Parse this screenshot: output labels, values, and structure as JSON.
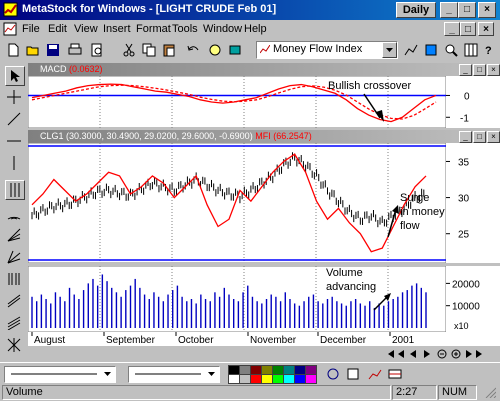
{
  "window": {
    "title": "MetaStock for Windows - [LIGHT CRUDE Feb 01]",
    "period_badge": "Daily",
    "control_min": "_",
    "control_max": "□",
    "control_close": "×"
  },
  "menu": {
    "items": [
      "File",
      "Edit",
      "View",
      "Insert",
      "Format",
      "Tools",
      "Window",
      "Help"
    ]
  },
  "toolbar": {
    "indicator_select": "Money Flow Index",
    "icons": [
      "new-icon",
      "open-icon",
      "save-icon",
      "print-icon",
      "cut-icon",
      "copy-icon",
      "paste-icon",
      "undo-icon",
      "explorer-icon",
      "expert-icon",
      "system-tester-icon",
      "indicator-builder-icon",
      "zoom-icon",
      "help-icon"
    ]
  },
  "macd_pane": {
    "label": "MACD",
    "value": "(0.0632)",
    "y_ticks": [
      "0",
      "-1"
    ],
    "annotation": "Bullish crossover"
  },
  "price_pane": {
    "label": "CLG1",
    "values": "(30.3000, 30.4900, 29.0200, 29.6000, -0.6900)",
    "mfi_label": "MFI",
    "mfi_value": "(66.2547)",
    "y_ticks": [
      "35",
      "30",
      "25"
    ],
    "annotation": "Surge in money flow"
  },
  "volume_pane": {
    "y_ticks": [
      "20000",
      "10000"
    ],
    "multiplier": "x10",
    "annotation": "Volume advancing"
  },
  "x_axis": {
    "labels": [
      "August",
      "September",
      "October",
      "November",
      "December",
      "2001"
    ]
  },
  "palette": {
    "colors": [
      "#000000",
      "#808080",
      "#800000",
      "#808000",
      "#008000",
      "#008080",
      "#000080",
      "#800080",
      "#ffffff",
      "#c0c0c0",
      "#ff0000",
      "#ffff00",
      "#00ff00",
      "#00ffff",
      "#0000ff",
      "#ff00ff"
    ]
  },
  "status": {
    "left": "Volume",
    "time": "2:27",
    "num": "NUM"
  },
  "chart_data": [
    {
      "type": "line",
      "pane": "MACD",
      "series": [
        {
          "name": "MACD",
          "values": [
            -0.1,
            0.0,
            0.1,
            0.2,
            0.35,
            0.45,
            0.5,
            0.52,
            0.5,
            0.4,
            0.3,
            0.2,
            0.15,
            0.05,
            -0.05,
            -0.2,
            -0.3,
            -0.35,
            -0.3,
            -0.2,
            -0.1,
            0.1,
            0.3,
            0.45,
            0.5,
            0.4,
            0.25,
            0.1,
            -0.2,
            -0.6,
            -0.9,
            -1.1,
            -1.2,
            -1.0,
            -0.6,
            -0.2,
            0.0
          ]
        },
        {
          "name": "Signal",
          "values": [
            -0.2,
            -0.1,
            0.0,
            0.1,
            0.2,
            0.3,
            0.4,
            0.45,
            0.47,
            0.45,
            0.4,
            0.33,
            0.25,
            0.15,
            0.05,
            -0.08,
            -0.18,
            -0.26,
            -0.29,
            -0.26,
            -0.2,
            -0.06,
            0.12,
            0.28,
            0.4,
            0.44,
            0.38,
            0.24,
            0.02,
            -0.3,
            -0.62,
            -0.88,
            -1.05,
            -1.08,
            -0.92,
            -0.62,
            -0.3
          ]
        }
      ],
      "ylim": [
        -1.4,
        0.8
      ]
    },
    {
      "type": "line",
      "pane": "Price",
      "series": [
        {
          "name": "CLG1",
          "values": [
            27.5,
            28.2,
            28.8,
            29.0,
            29.5,
            30.2,
            30.8,
            31.0,
            30.6,
            30.3,
            31.2,
            32.0,
            31.5,
            31.0,
            31.8,
            32.5,
            31.8,
            31.0,
            30.5,
            30.2,
            31.0,
            32.0,
            33.0,
            34.5,
            35.5,
            34.5,
            33.0,
            31.0,
            29.5,
            28.0,
            27.0,
            27.5,
            26.5,
            27.5,
            28.5,
            30.0,
            30.5
          ]
        },
        {
          "name": "MFI",
          "values": [
            29.0,
            30.5,
            32.5,
            31.0,
            29.5,
            30.5,
            32.0,
            33.5,
            33.0,
            30.5,
            31.5,
            33.0,
            32.0,
            30.0,
            31.5,
            33.0,
            29.0,
            26.0,
            27.0,
            31.0,
            29.5,
            31.5,
            33.5,
            35.0,
            36.0,
            33.5,
            29.5,
            27.0,
            28.5,
            26.5,
            25.0,
            22.5,
            23.0,
            26.0,
            29.0,
            31.5,
            33.0
          ]
        }
      ],
      "ylim": [
        21.5,
        37.0
      ]
    },
    {
      "type": "bar",
      "pane": "Volume",
      "values": [
        14,
        12,
        15,
        13,
        11,
        16,
        14,
        12,
        18,
        15,
        13,
        17,
        20,
        22,
        19,
        24,
        21,
        18,
        16,
        14,
        17,
        19,
        22,
        18,
        15,
        13,
        16,
        14,
        12,
        15,
        17,
        19,
        14,
        12,
        13,
        11,
        15,
        13,
        12,
        16,
        14,
        18,
        15,
        13,
        12,
        16,
        19,
        14,
        12,
        11,
        13,
        15,
        14,
        12,
        16,
        13,
        11,
        10,
        12,
        14,
        15,
        12,
        11,
        13,
        14,
        12,
        11,
        10,
        12,
        13,
        11,
        10,
        12,
        9,
        11,
        10,
        12,
        13,
        14,
        16,
        17,
        19,
        20,
        18,
        16
      ],
      "ylim": [
        0,
        26000
      ]
    }
  ]
}
